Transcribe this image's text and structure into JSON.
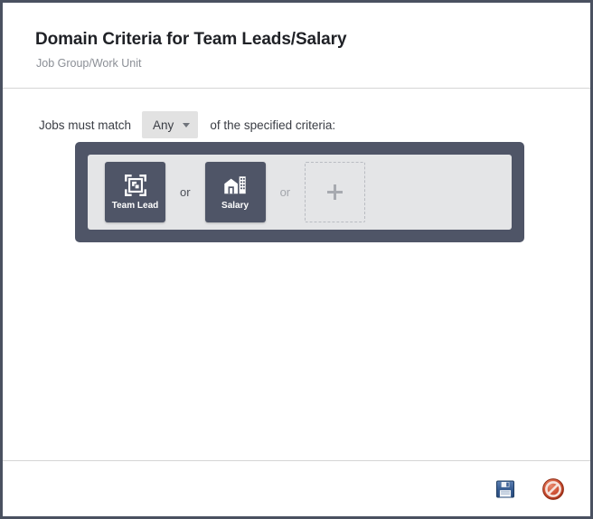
{
  "dialog": {
    "title": "Domain Criteria for Team Leads/Salary",
    "subtitle": "Job Group/Work Unit",
    "border_color": "#4a5160"
  },
  "match_row": {
    "prefix_text": "Jobs must match",
    "selected_option": "Any",
    "suffix_text": "of the specified criteria:",
    "caret_icon": "chevron-down-icon",
    "select_background": "#e2e2e2"
  },
  "criteria_panel": {
    "panel_color": "#4f5567",
    "inner_color": "#e4e5e7",
    "separator_label": "or",
    "tiles": [
      {
        "label": "Team Lead",
        "icon": "team-lead-icon"
      },
      {
        "label": "Salary",
        "icon": "building-icon"
      }
    ],
    "add_tile": {
      "icon": "plus-icon",
      "label": ""
    }
  },
  "footer": {
    "buttons": [
      {
        "name": "save-button",
        "icon": "floppy-disk-save-icon",
        "color": "#2a5b9c"
      },
      {
        "name": "cancel-button",
        "icon": "prohibited-cancel-icon",
        "color": "#c0392b"
      }
    ]
  }
}
